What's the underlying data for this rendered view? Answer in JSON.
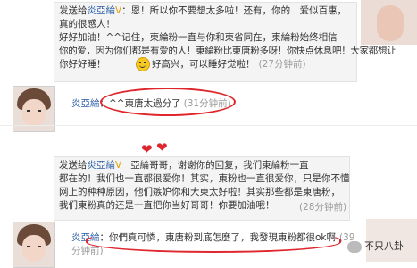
{
  "post1": {
    "name": "炎亞綸",
    "line1_prefix": "发送给",
    "line1_text": "：恩！所以你不要想太多啦！还有，你的　爱似百惠，",
    "line2": "真的很感人！",
    "line3": "好好加油！^^记住，東綸粉一直与你和東省同在，東綸粉始终相信",
    "line4": "你的爱，因为你们都是有爱的人！東綸粉比東唐粉多呀！你快点休息吧！大家都想让",
    "line5": "你好好睡！",
    "line6_text": "好高兴，可以睡好觉啦！",
    "time": "(27分钟前)"
  },
  "reply1": {
    "name": "炎亞綸",
    "text": "：^^東唐太過分了",
    "time": "(31分钟前)"
  },
  "post2": {
    "line1_prefix": "发送给",
    "name": "炎亞綸",
    "line1_text": "亞綸哥哥，谢谢你的回复，我们東綸粉一直",
    "line2": "都在的！我们也一直都很爱你！其实，東粉也一直很爱你，只是你不懂",
    "line3": "网上的种种原因，他们嫉妒你和大東太好啦！其实那些都是東唐粉，",
    "line4": "我们東粉真的还是一直把你当好哥哥！你要加油哦！",
    "time": "(28分钟前)"
  },
  "reply2": {
    "name": "炎亞綸",
    "line1": "：你們真可憐，東唐粉到底怎麼了，我發現東粉都很ok啊",
    "time1": "(39",
    "line2": "分钟前)"
  },
  "watermark": {
    "text": "不只八卦"
  },
  "colors": {
    "name": "#2b5ea9",
    "highlight": "#e0262d",
    "time": "#9a9a9a"
  }
}
